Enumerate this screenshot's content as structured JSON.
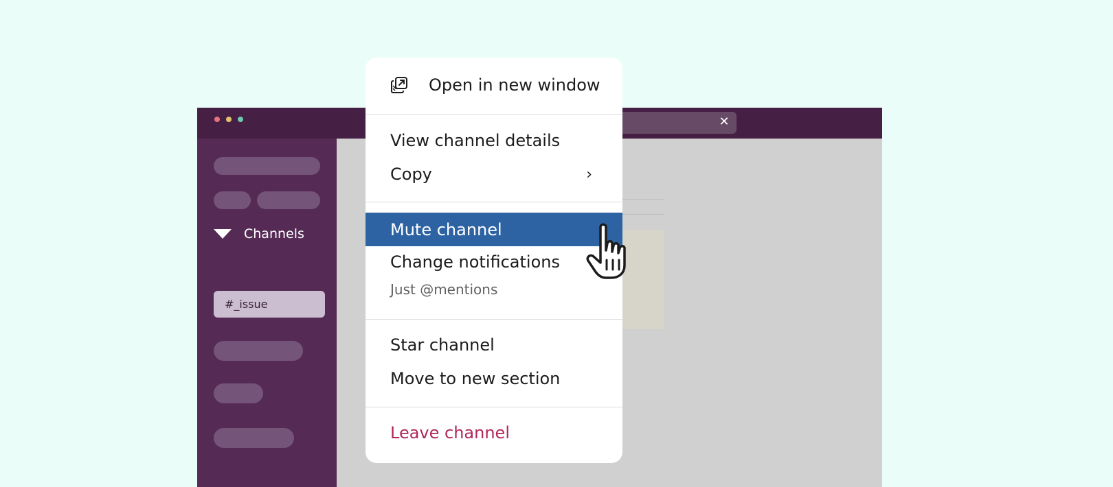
{
  "window": {
    "traffic_colors": [
      "#e8727f",
      "#e1c36c",
      "#6fc9b1"
    ],
    "search_close_glyph": "✕"
  },
  "sidebar": {
    "section_label": "Channels",
    "active_channel": "#_issue"
  },
  "context_menu": {
    "open_in_new_window": "Open in new window",
    "view_channel_details": "View channel details",
    "copy": "Copy",
    "copy_submenu_glyph": "›",
    "mute_channel": "Mute channel",
    "change_notifications": "Change notifications",
    "notification_setting": "Just @mentions",
    "star_channel": "Star channel",
    "move_to_new_section": "Move to new section",
    "leave_channel": "Leave channel"
  },
  "colors": {
    "page_background": "#eafdf8",
    "titlebar": "#461f45",
    "sidebar": "#552b55",
    "highlight": "#2e63a3",
    "danger": "#b0275a"
  },
  "icons": {
    "open_window": "open-in-new-window-icon",
    "cursor": "hand-pointer-icon",
    "section_toggle": "caret-down-icon"
  }
}
